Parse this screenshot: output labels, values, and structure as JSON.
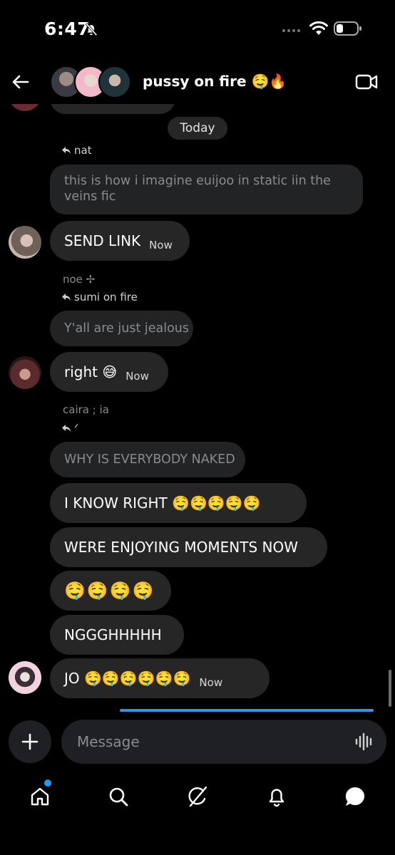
{
  "status_bar": {
    "time": "6:47"
  },
  "header": {
    "title": "pussy on fire 🤤🔥"
  },
  "chat": {
    "date_divider": "Today",
    "messages": [
      {
        "reply_to": "nat",
        "quoted_text": "this is how i imagine euijoo in static iin the veins fic"
      },
      {
        "text": "SEND LINK",
        "time": "Now"
      },
      {
        "sender": "noe ✢",
        "reply_to": "sumi on fire",
        "quoted_text": "Y'all are just jealous"
      },
      {
        "text": "right 😅",
        "time": "Now"
      },
      {
        "sender": "caira ; ia",
        "reply_to": "ᐟ",
        "quoted_text": "WHY IS EVERYBODY NAKED"
      },
      {
        "text": "I KNOW RIGHT 🤤🤤🤤🤤🤤"
      },
      {
        "text": "WERE ENJOYING MOMENTS NOW"
      },
      {
        "text": "🤤🤤🤤🤤"
      },
      {
        "text": "NGGGHHHHH"
      },
      {
        "text": "JO 🤤🤤🤤🤤🤤🤤",
        "time": "Now"
      }
    ]
  },
  "composer": {
    "placeholder": "Message"
  },
  "tabs": [
    "home",
    "search",
    "grok",
    "notifications",
    "messages"
  ],
  "colors": {
    "accent": "#1d9bf0",
    "bubble": "#262626",
    "background": "#000000"
  }
}
